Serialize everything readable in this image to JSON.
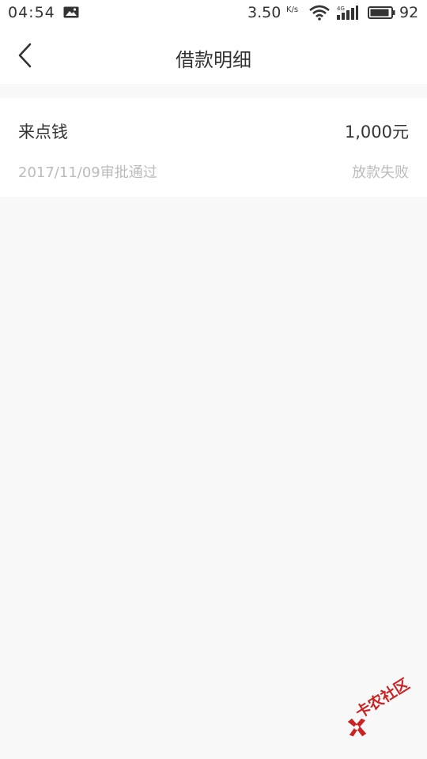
{
  "status_bar": {
    "time": "04:54",
    "net_speed": "3.50",
    "net_speed_unit": "K/s",
    "network_label": "4G",
    "battery": "92",
    "battery_level": 0.92
  },
  "header": {
    "title": "借款明细"
  },
  "loan": {
    "name": "来点钱",
    "amount": "1,000元",
    "date_status": "2017/11/09审批通过",
    "result": "放款失败"
  },
  "watermark": {
    "text": "卡农社区"
  },
  "colors": {
    "background": "#f8f8f8",
    "card": "#ffffff",
    "text_primary": "#333333",
    "text_secondary": "#bbbbbb",
    "watermark": "#cc2222"
  }
}
